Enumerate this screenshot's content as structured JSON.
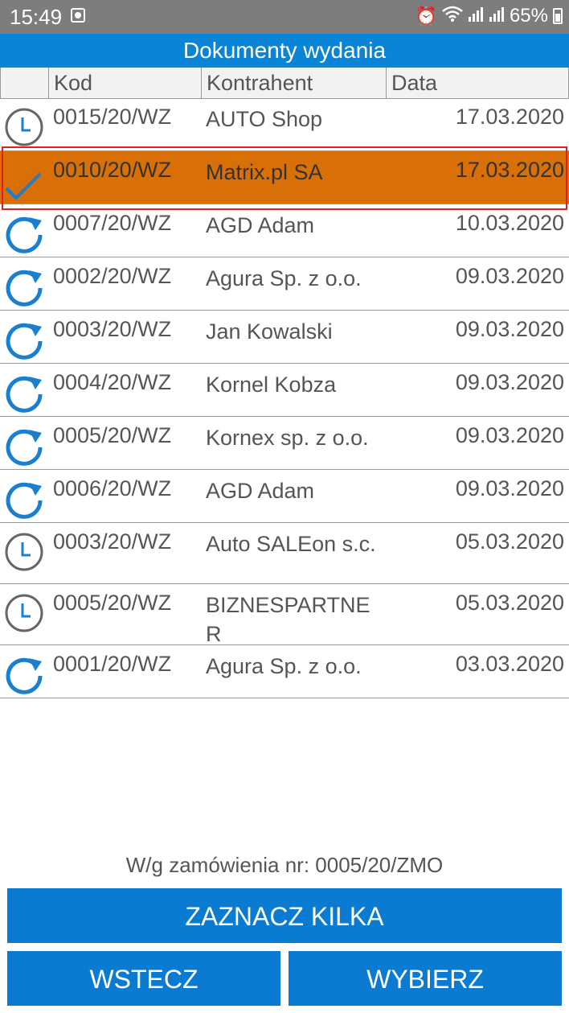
{
  "status": {
    "time": "15:49",
    "battery": "65%"
  },
  "title": "Dokumenty wydania",
  "columns": {
    "icon": "",
    "kod": "Kod",
    "kontrahent": "Kontrahent",
    "data": "Data"
  },
  "rows": [
    {
      "icon": "clock-icon",
      "kod": "0015/20/WZ",
      "kontrahent": "AUTO Shop",
      "data": "17.03.2020"
    },
    {
      "icon": "checkmark-icon",
      "kod": "0010/20/WZ",
      "kontrahent": "Matrix.pl SA",
      "data": "17.03.2020",
      "selected": true
    },
    {
      "icon": "refresh-icon",
      "kod": "0007/20/WZ",
      "kontrahent": "AGD Adam",
      "data": "10.03.2020"
    },
    {
      "icon": "refresh-icon",
      "kod": "0002/20/WZ",
      "kontrahent": "Agura Sp. z o.o.",
      "data": "09.03.2020"
    },
    {
      "icon": "refresh-icon",
      "kod": "0003/20/WZ",
      "kontrahent": "Jan Kowalski",
      "data": "09.03.2020"
    },
    {
      "icon": "refresh-icon",
      "kod": "0004/20/WZ",
      "kontrahent": "Kornel Kobza",
      "data": "09.03.2020"
    },
    {
      "icon": "refresh-icon",
      "kod": "0005/20/WZ",
      "kontrahent": "Kornex sp. z o.o.",
      "data": "09.03.2020"
    },
    {
      "icon": "refresh-icon",
      "kod": "0006/20/WZ",
      "kontrahent": "AGD Adam",
      "data": "09.03.2020"
    },
    {
      "icon": "clock-icon",
      "kod": "0003/20/WZ",
      "kontrahent": "Auto SALEon s.c.",
      "data": "05.03.2020"
    },
    {
      "icon": "clock-icon",
      "kod": "0005/20/WZ",
      "kontrahent": "BIZNESPARTNE R",
      "data": "05.03.2020"
    },
    {
      "icon": "refresh-icon",
      "kod": "0001/20/WZ",
      "kontrahent": "Agura Sp. z o.o.",
      "data": "03.03.2020"
    }
  ],
  "order_info": "W/g zamówienia nr: 0005/20/ZMO",
  "buttons": {
    "multi": "ZAZNACZ KILKA",
    "back": "WSTECZ",
    "select": "WYBIERZ"
  },
  "colors": {
    "accent": "#0a84d6",
    "selected": "#d96f07",
    "icon_blue": "#1a7fcf",
    "icon_gray": "#666666"
  }
}
